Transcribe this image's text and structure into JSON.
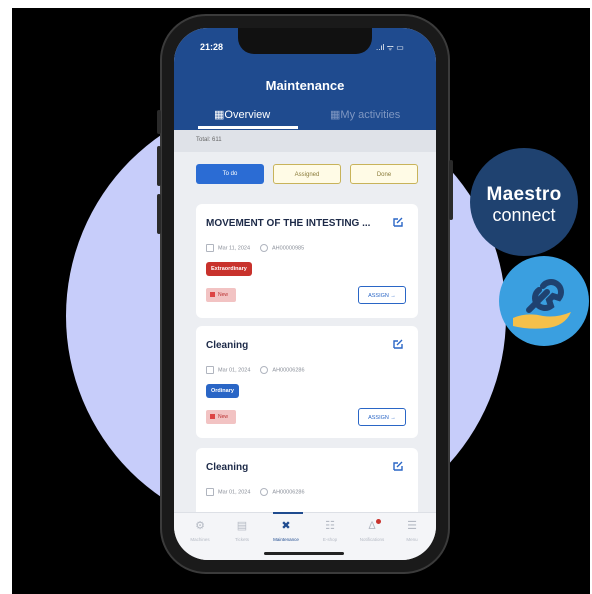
{
  "status": {
    "time": "21:28",
    "icons": "..ıl ᯤ ▭"
  },
  "header": {
    "title": "Maintenance"
  },
  "tabs": [
    {
      "label": "Overview",
      "active": true
    },
    {
      "label": "My activities",
      "active": false
    }
  ],
  "total": "Total: 611",
  "filters": [
    "To do",
    "Assigned",
    "Done"
  ],
  "cards": [
    {
      "title": "MOVEMENT OF THE INTESTING ...",
      "date": "Mar 11, 2024",
      "code": "AH00000985",
      "badge": "Extraordinary",
      "status": "New",
      "action": "ASSIGN →"
    },
    {
      "title": "Cleaning",
      "date": "Mar 01, 2024",
      "code": "AH00006286",
      "badge": "Ordinary",
      "status": "New",
      "action": "ASSIGN →"
    },
    {
      "title": "Cleaning",
      "date": "Mar 01, 2024",
      "code": "AH00006286"
    }
  ],
  "nav": [
    {
      "label": "Machines",
      "icon": "gear-icon",
      "glyph": "⚙"
    },
    {
      "label": "Tickets",
      "icon": "ticket-icon",
      "glyph": "▤"
    },
    {
      "label": "Maintenance",
      "icon": "tools-icon",
      "glyph": "✖",
      "active": true
    },
    {
      "label": "E-shop",
      "icon": "cart-icon",
      "glyph": "☷"
    },
    {
      "label": "Notifications",
      "icon": "bell-icon",
      "glyph": "Δ"
    },
    {
      "label": "Menu",
      "icon": "menu-icon",
      "glyph": "☰"
    }
  ],
  "brand": {
    "line1": "Maestro",
    "line2": "connect"
  },
  "colors": {
    "primary": "#1f4b8f",
    "accent": "#2b6cd4",
    "danger": "#c8322c",
    "circle": "#c7cdfa"
  }
}
